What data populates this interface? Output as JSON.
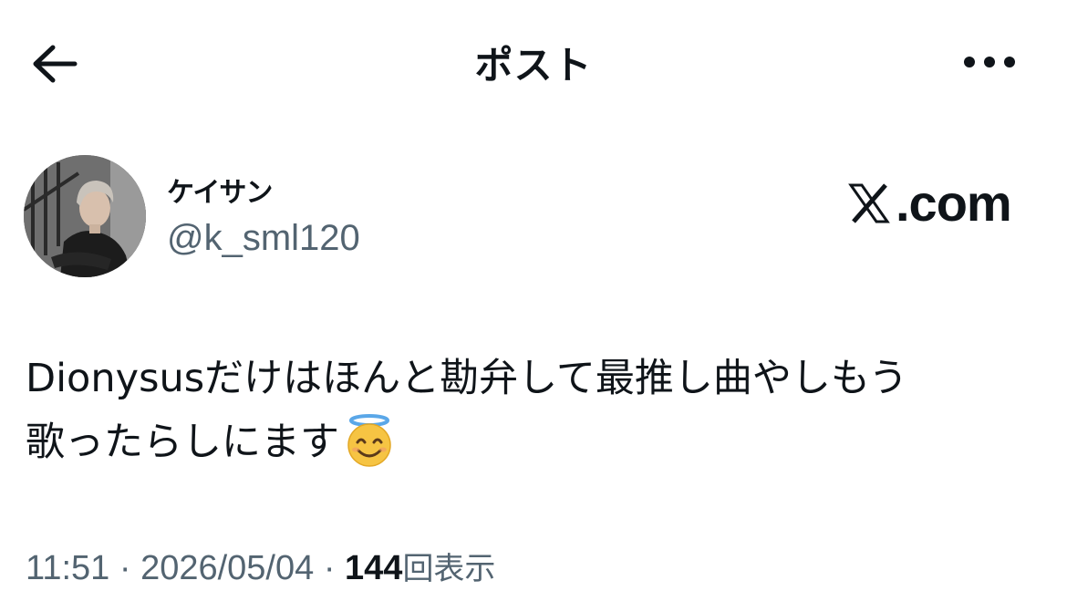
{
  "header": {
    "title": "ポスト",
    "back_icon": "arrow-left-icon",
    "more_icon": "more-horizontal-icon"
  },
  "author": {
    "display_name": "ケイサン",
    "handle": "@k_sml120"
  },
  "watermark": {
    "text": ".com",
    "logo_icon": "x-logo-icon"
  },
  "post": {
    "line1": "Dionysusだけはほんと勘弁して最推し曲やしもう",
    "line2": "歌ったらしにます",
    "emoji": "smiling-face-with-halo-icon"
  },
  "meta": {
    "time": "11:51",
    "separator": "·",
    "date": "2026/05/04",
    "views_count": "144",
    "views_label": "回表示"
  },
  "colors": {
    "text_primary": "#0f1419",
    "text_secondary": "#536471",
    "background": "#ffffff"
  }
}
